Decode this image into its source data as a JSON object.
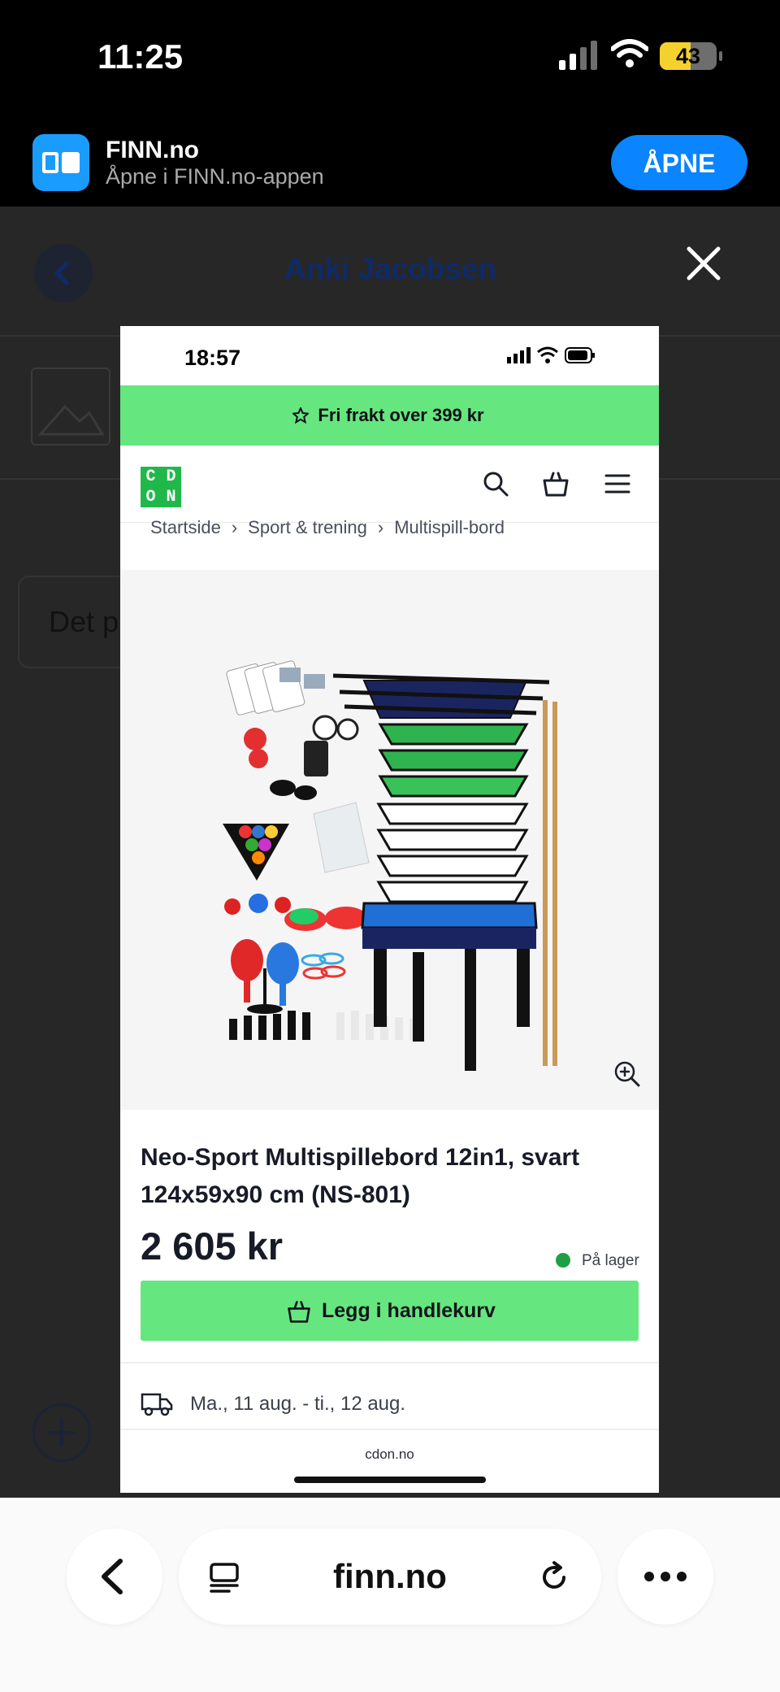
{
  "status_bar": {
    "time": "11:25",
    "battery": "43"
  },
  "app_banner": {
    "app_name": "FINN.no",
    "subtitle": "Åpne i FINN.no-appen",
    "open_label": "ÅPNE",
    "icon": "finn-app-icon"
  },
  "background_page": {
    "header_title": "Anki Jacobsen",
    "message_preview": "Det p"
  },
  "screenshot": {
    "time": "18:57",
    "promo": "Fri frakt over 399 kr",
    "logo_letters": [
      "C",
      "D",
      "O",
      "N"
    ],
    "breadcrumbs": [
      "Startside",
      "Sport & trening",
      "Multispill-bord"
    ],
    "product_title": "Neo-Sport Multispillebord 12in1, svart 124x59x90 cm (NS-801)",
    "price": "2 605 kr",
    "stock": "På lager",
    "cart_button": "Legg i handlekurv",
    "delivery": "Ma., 11 aug. - ti., 12 aug.",
    "domain": "cdon.no",
    "colors": {
      "green": "#66e67e",
      "stock_dot": "#1f9f45"
    }
  },
  "safari": {
    "url": "finn.no"
  }
}
